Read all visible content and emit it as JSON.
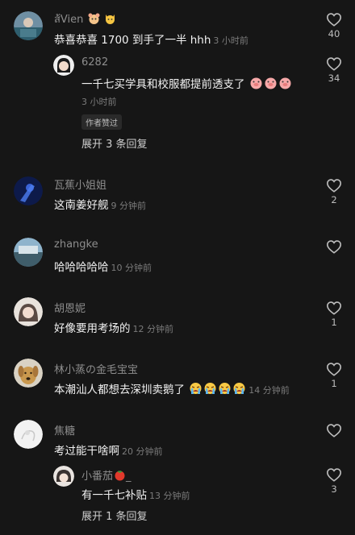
{
  "comments": [
    {
      "name": "ส้Vien",
      "text": "恭喜恭喜 1700 到手了一半 hhh",
      "time": "3 小时前",
      "likes": "40",
      "reply": {
        "name": "6282",
        "text": "一千七买学具和校服都提前透支了",
        "time": "3 小时前",
        "likes": "34",
        "badge": "作者赞过"
      },
      "expand": "展开 3 条回复"
    },
    {
      "name": "瓦蕉小姐姐",
      "text": "这南姜好舰",
      "time": "9 分钟前",
      "likes": "2"
    },
    {
      "name": "zhangke",
      "text": "哈哈哈哈哈",
      "time": "10 分钟前",
      "likes": ""
    },
    {
      "name": "胡恩妮",
      "text": "好像要用考场的",
      "time": "12 分钟前",
      "likes": "1"
    },
    {
      "name": "林小蒸の金毛宝宝",
      "text": "本潮汕人都想去深圳卖鹅了",
      "time": "14 分钟前",
      "likes": "1"
    },
    {
      "name": "焦糖",
      "text": "考过能干啥啊",
      "time": "20 分钟前",
      "likes": "",
      "reply": {
        "name": "小番茄",
        "name_suffix": "_",
        "text": "有一千七补贴",
        "time": "13 分钟前",
        "likes": "3"
      },
      "expand": "展开 1 条回复"
    }
  ],
  "icons": {
    "like": "heart-outline-icon",
    "pig": "pig-face-emoji",
    "cry": "crying-face-emoji",
    "tomato": "tomato-emoji",
    "name_badges": [
      "hamster-emoji",
      "cat-emoji"
    ]
  },
  "colors": {
    "background": "#161616",
    "name": "#8d8d8d",
    "time": "#7b7b7b",
    "text": "#f2f2f2"
  }
}
